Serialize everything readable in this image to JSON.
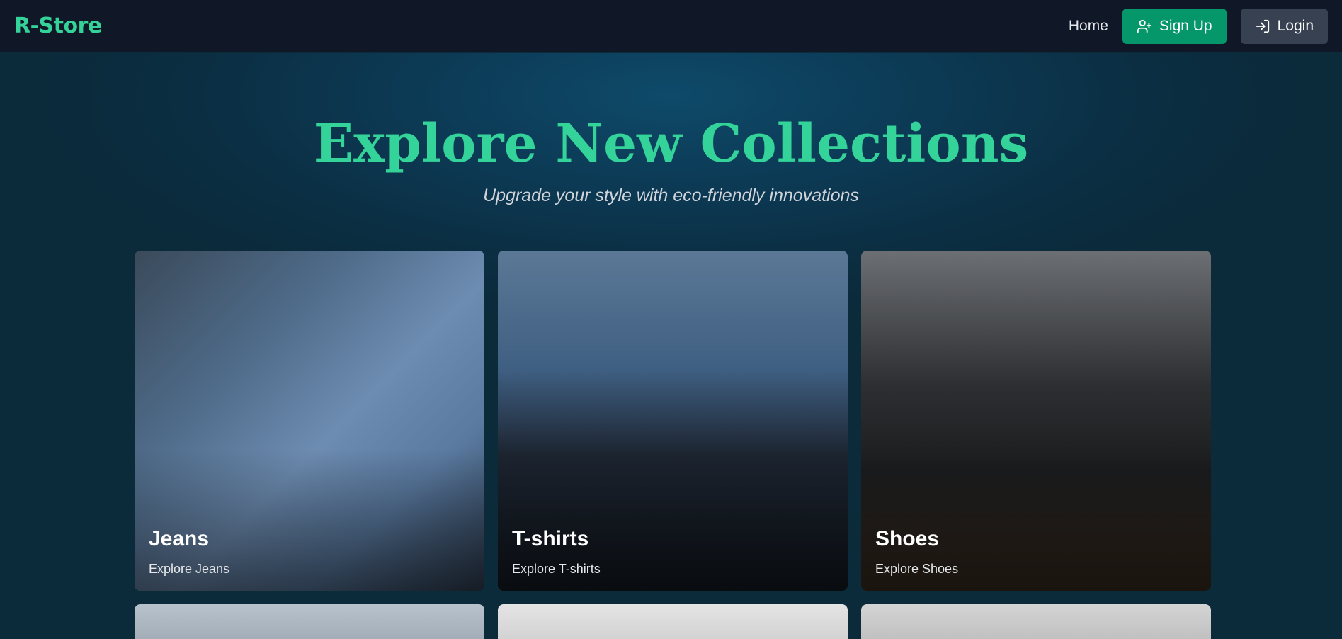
{
  "navbar": {
    "logo": "R-Store",
    "home_label": "Home",
    "signup_label": "Sign Up",
    "login_label": "Login"
  },
  "hero": {
    "title": "Explore New Collections",
    "subtitle": "Upgrade your style with eco-friendly innovations"
  },
  "collections": [
    {
      "title": "Jeans",
      "subtitle": "Explore Jeans"
    },
    {
      "title": "T-shirts",
      "subtitle": "Explore T-shirts"
    },
    {
      "title": "Shoes",
      "subtitle": "Explore Shoes"
    }
  ],
  "colors": {
    "accent": "#34d399",
    "signup_button": "#059669",
    "login_button": "#374151",
    "navbar_bg": "#101828"
  }
}
